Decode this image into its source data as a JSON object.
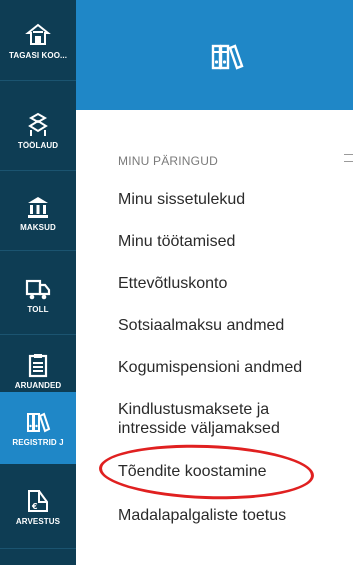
{
  "sidebar": {
    "items": [
      {
        "label": "TAGASI KOO...",
        "icon": "home-icon"
      },
      {
        "label": "TÖÖLAUD",
        "icon": "desk-icon"
      },
      {
        "label": "MAKSUD",
        "icon": "bank-icon"
      },
      {
        "label": "TOLL",
        "icon": "truck-icon"
      },
      {
        "label": "ARUANDED",
        "icon": "clipboard-icon"
      },
      {
        "label": "REGISTRID J",
        "icon": "binders-icon",
        "active": true
      },
      {
        "label": "ARVESTUS",
        "icon": "calculation-icon"
      }
    ]
  },
  "header": {
    "icon": "binders-icon"
  },
  "panel": {
    "section_title": "MINU PÄRINGUD",
    "menu_icon": "hamburger-icon",
    "links": [
      "Minu sissetulekud",
      "Minu töötamised",
      "Ettevõtluskonto",
      "Sotsiaalmaksu andmed",
      "Kogumispensioni andmed",
      "Kindlustusmaksete ja intresside väljamaksed",
      "Tõendite koostamine",
      "Madalapalgaliste toetus"
    ],
    "annotation": {
      "type": "red-oval",
      "target": "Tõendite koostamine",
      "color": "#e02020"
    }
  },
  "colors": {
    "rail": "#0e3d54",
    "accent": "#1f87c7",
    "text": "#2a2a2a",
    "muted": "#7a7a7a"
  }
}
